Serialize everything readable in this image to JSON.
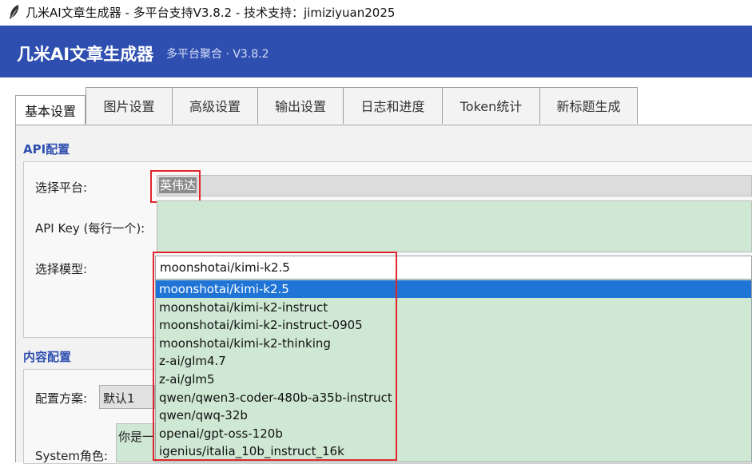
{
  "window": {
    "title": "几米AI文章生成器 - 多平台支持V3.8.2 - 技术支持：jimiziyuan2025",
    "icon": "feather-icon"
  },
  "header": {
    "app_name": "几米AI文章生成器",
    "subtitle": "多平台聚合 · V3.8.2",
    "color": "#2f4fb0"
  },
  "tabs": [
    {
      "label": "基本设置",
      "active": true
    },
    {
      "label": "图片设置"
    },
    {
      "label": "高级设置"
    },
    {
      "label": "输出设置"
    },
    {
      "label": "日志和进度"
    },
    {
      "label": "Token统计"
    },
    {
      "label": "新标题生成"
    }
  ],
  "api_section": {
    "title": "API配置",
    "platform_label": "选择平台:",
    "platform_value": "英伟达",
    "api_key_label": "API Key (每行一个):",
    "api_key_value": "",
    "model_label": "选择模型:",
    "model_value": "moonshotai/kimi-k2.5",
    "model_options": [
      "moonshotai/kimi-k2.5",
      "moonshotai/kimi-k2-instruct",
      "moonshotai/kimi-k2-instruct-0905",
      "moonshotai/kimi-k2-thinking",
      "z-ai/glm4.7",
      "z-ai/glm5",
      "qwen/qwen3-coder-480b-a35b-instruct",
      "qwen/qwq-32b",
      "openai/gpt-oss-120b",
      "igenius/italia_10b_instruct_16k"
    ],
    "selected_option_index": 0
  },
  "content_section": {
    "title": "内容配置",
    "scheme_label": "配置方案:",
    "scheme_value": "默认1",
    "system_label": "System角色:",
    "system_value": "你是一"
  },
  "colors": {
    "accent": "#2f4fb0",
    "selection": "#1f74d6",
    "input_green": "#cfe8d3",
    "highlight_red": "#e0262d"
  }
}
